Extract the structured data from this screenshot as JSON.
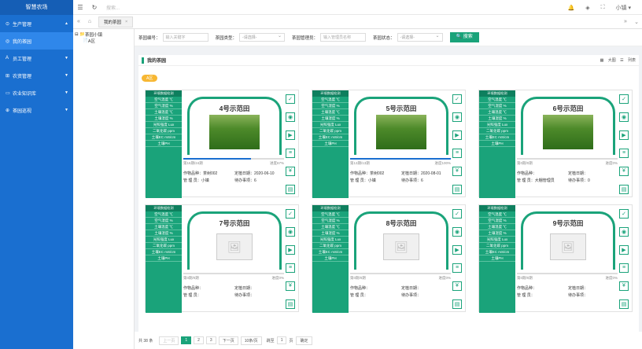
{
  "app_title": "智慧农场",
  "sidebar": {
    "items": [
      {
        "label": "生产管理",
        "icon": "leaf-icon",
        "arrow": "▲"
      },
      {
        "label": "我的茶园",
        "icon": "circle-icon",
        "arrow": ""
      },
      {
        "label": "员工管理",
        "icon": "user-icon",
        "arrow": "▼"
      },
      {
        "label": "农资管理",
        "icon": "box-icon",
        "arrow": "▼"
      },
      {
        "label": "农业知识库",
        "icon": "book-icon",
        "arrow": "▼"
      },
      {
        "label": "茶园巡视",
        "icon": "search-icon",
        "arrow": "▼"
      }
    ]
  },
  "topbar": {
    "search_placeholder": "搜索...",
    "user": "小镇"
  },
  "tabs": [
    {
      "label": "我的茶园"
    }
  ],
  "tree": {
    "root": "茶园小镇",
    "child": "A区"
  },
  "filter": {
    "f1_label": "茶园编号：",
    "f1_placeholder": "输入关键字",
    "f2_label": "茶园类型：",
    "f2_value": "-请选择-",
    "f3_label": "茶园管理员：",
    "f3_placeholder": "输入管理员名称",
    "f4_label": "茶园状态：",
    "f4_value": "-请选择-",
    "search_btn": "搜索"
  },
  "panel": {
    "title": "我的茶园",
    "view_large": "大图",
    "view_list": "列表",
    "tag": "A区"
  },
  "env_title": "环境数据检测",
  "cards": [
    {
      "title": "4号示范田",
      "has_photo": true,
      "progress_left": "第16期/24期",
      "progress_right": "进度67%",
      "progress": 0.67,
      "crop": "作物品种：茶树002",
      "plant_date": "定植日期：2020-06-10",
      "manager": "管 理 员：小镇",
      "todo": "待办事项：6"
    },
    {
      "title": "5号示范田",
      "has_photo": true,
      "progress_left": "第13期/13期",
      "progress_right": "进度100%",
      "progress": 1.0,
      "crop": "作物品种：茶树002",
      "plant_date": "定植日期：2020-08-01",
      "manager": "管 理 员：小镇",
      "todo": "待办事项：6"
    },
    {
      "title": "6号示范田",
      "has_photo": true,
      "progress_left": "第0期/0期",
      "progress_right": "进度0%",
      "progress": 0.0,
      "crop": "作物品种：",
      "plant_date": "定植日期：",
      "manager": "管 理 员：大棚管理员",
      "todo": "待办事项：0"
    },
    {
      "title": "7号示范田",
      "has_photo": false,
      "progress_left": "第0期/0期",
      "progress_right": "进度0%",
      "progress": 0.0,
      "crop": "作物品种：",
      "plant_date": "定植日期：",
      "manager": "管 理 员：",
      "todo": "待办事项："
    },
    {
      "title": "8号示范田",
      "has_photo": false,
      "progress_left": "第0期/0期",
      "progress_right": "进度0%",
      "progress": 0.0,
      "crop": "作物品种：",
      "plant_date": "定植日期：",
      "manager": "管 理 员：",
      "todo": "待办事项："
    },
    {
      "title": "9号示范田",
      "has_photo": false,
      "progress_left": "第0期/0期",
      "progress_right": "进度0%",
      "progress": 0.0,
      "crop": "作物品种：",
      "plant_date": "定植日期：",
      "manager": "管 理 员：",
      "todo": "待办事项："
    }
  ],
  "env_rows": [
    "空气温度 ℃",
    "空气湿度 %",
    "土壤温度 ℃",
    "土壤湿度 %",
    "光照强度 Lux",
    "二氧化碳 ppm",
    "土壤EC mS/cm",
    "土壤PH"
  ],
  "pager": {
    "total": "共 38 条",
    "prev": "上一页",
    "p1": "1",
    "p2": "2",
    "p3": "3",
    "next": "下一页",
    "size": "10条/页",
    "goto": "跳至",
    "page": "1",
    "unit": "页",
    "confirm": "确定"
  }
}
